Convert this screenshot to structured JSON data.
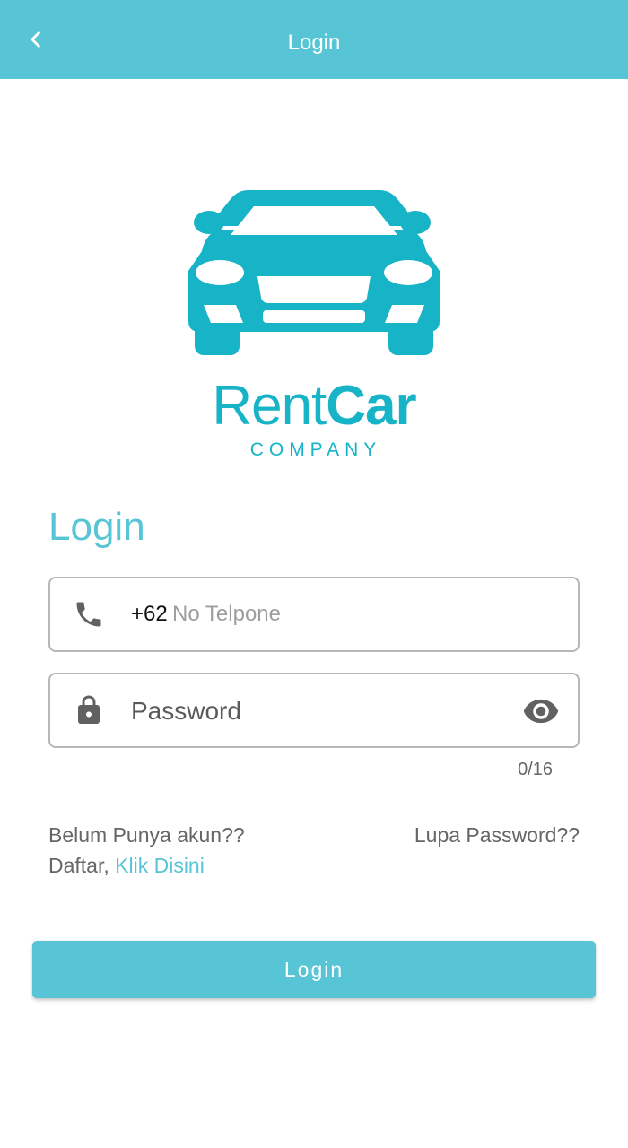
{
  "appbar": {
    "title": "Login",
    "back_icon": "chevron-left-icon",
    "background": "#57c5d5"
  },
  "brand": {
    "logo_icon": "car-front-icon",
    "name_regular": "Rent",
    "name_bold": "Car",
    "tagline": "COMPANY",
    "color": "#17b3c6"
  },
  "form": {
    "title": "Login",
    "phone": {
      "icon": "phone-icon",
      "prefix": "+62",
      "placeholder": "No Telpone",
      "value": ""
    },
    "password": {
      "icon": "lock-icon",
      "placeholder": "Password",
      "value": "",
      "visibility_icon": "eye-icon",
      "counter": "0/16"
    }
  },
  "links": {
    "register_prompt": "Belum Punya akun??",
    "register_prefix": "Daftar,",
    "register_link": "Klik Disini",
    "forgot_password": "Lupa Password??"
  },
  "actions": {
    "login_label": "Login"
  },
  "colors": {
    "accent": "#57c5d5",
    "text_muted": "#666666",
    "border": "#b7b7b7"
  }
}
